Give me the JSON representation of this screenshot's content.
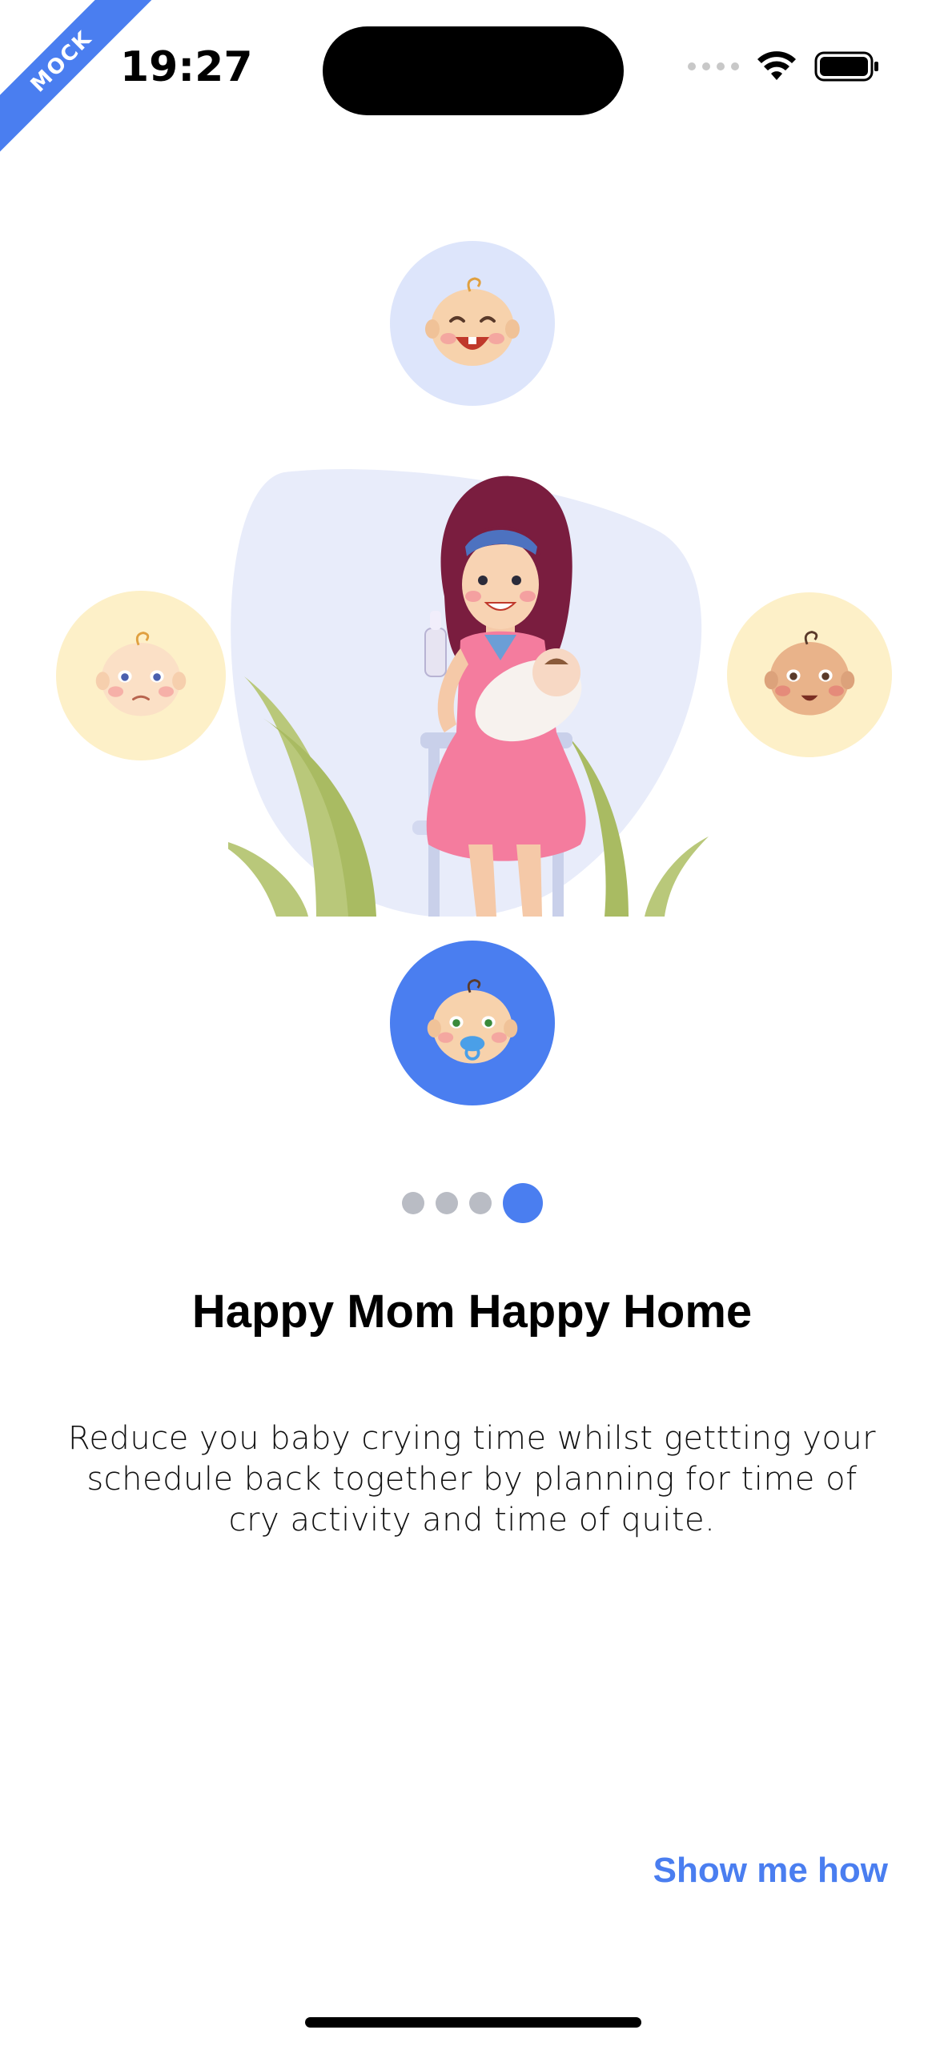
{
  "status_bar": {
    "time": "19:27",
    "icons": [
      "signal-icon",
      "wifi-icon",
      "battery-icon"
    ]
  },
  "ribbon": {
    "label": "MOCK"
  },
  "illustration": {
    "avatars": [
      "baby-crying-icon",
      "baby-sad-icon",
      "baby-happy-icon",
      "baby-pacifier-icon"
    ],
    "hero": "mom-holding-baby-illustration"
  },
  "pager": {
    "count": 4,
    "active_index": 3
  },
  "content": {
    "title": "Happy Mom Happy Home",
    "description": "Reduce you baby crying time whilst gettting your schedule back together by planning for time of cry activity and time of quite."
  },
  "actions": {
    "primary_label": "Show me how"
  },
  "colors": {
    "accent": "#4a7ef0",
    "soft_blue": "#dde5fb",
    "soft_yellow": "#fdf0c8",
    "dot_inactive": "#b9bcc4"
  }
}
